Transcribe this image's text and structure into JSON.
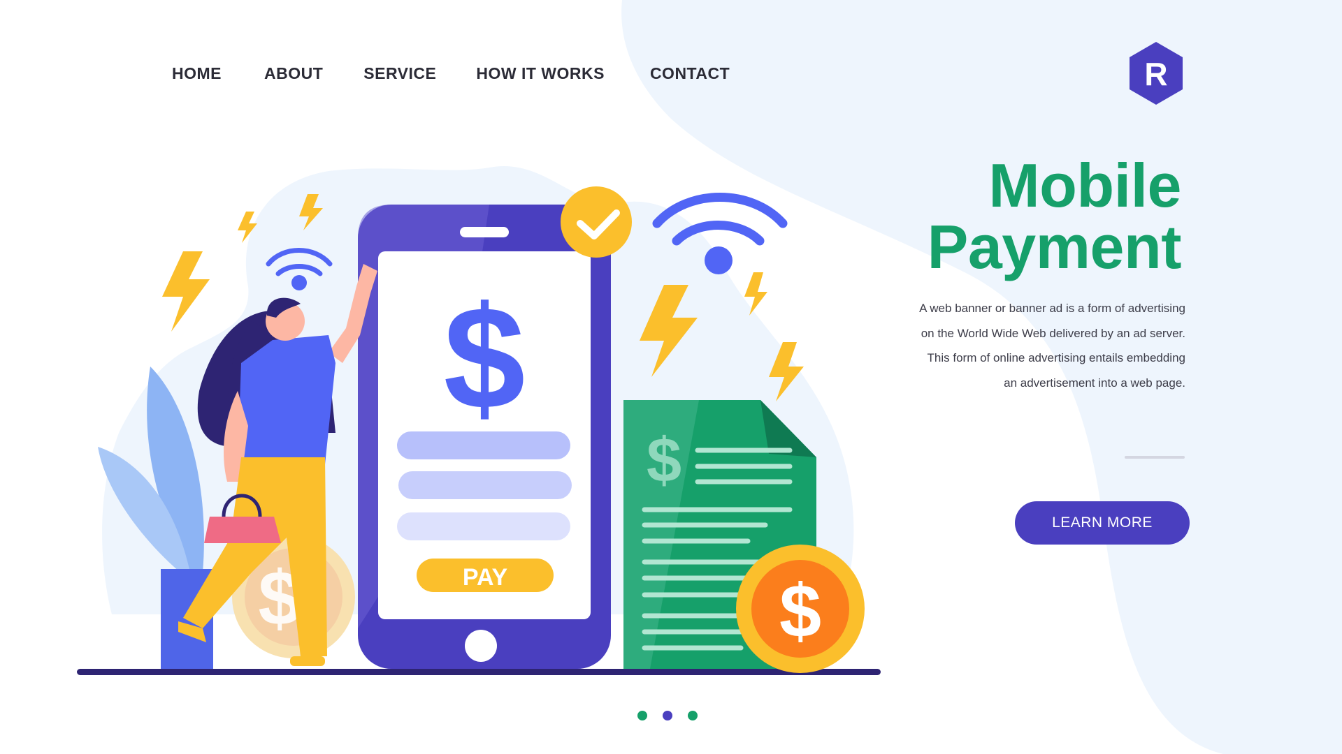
{
  "nav": {
    "items": [
      "HOME",
      "ABOUT",
      "SERVICE",
      "HOW IT WORKS",
      "CONTACT"
    ]
  },
  "logo": {
    "letter": "R"
  },
  "hero": {
    "title_line1": "Mobile",
    "title_line2": "Payment",
    "description": [
      "A web banner or banner ad is a form of advertising",
      "on the World Wide Web delivered by an ad server.",
      "This form of online advertising entails embedding",
      "an advertisement into a web page."
    ],
    "cta_label": "LEARN MORE"
  },
  "illustration": {
    "phone_symbol": "$",
    "pay_label": "PAY",
    "receipt_symbol": "$",
    "coin_symbol": "$",
    "icons": [
      "wifi-icon",
      "wifi-icon",
      "check-icon",
      "lightning-icon",
      "dollar-coin-icon",
      "receipt-icon",
      "shopping-bag-icon"
    ]
  },
  "carousel": {
    "dot_colors": [
      "#16a06a",
      "#4a3fbf",
      "#16a06a"
    ]
  },
  "colors": {
    "brand_green": "#16a06a",
    "brand_purple": "#4a3fbf",
    "background_blob": "#eef5fd",
    "accent_yellow": "#fbbf2c",
    "dollar_blue": "#5165f5"
  }
}
